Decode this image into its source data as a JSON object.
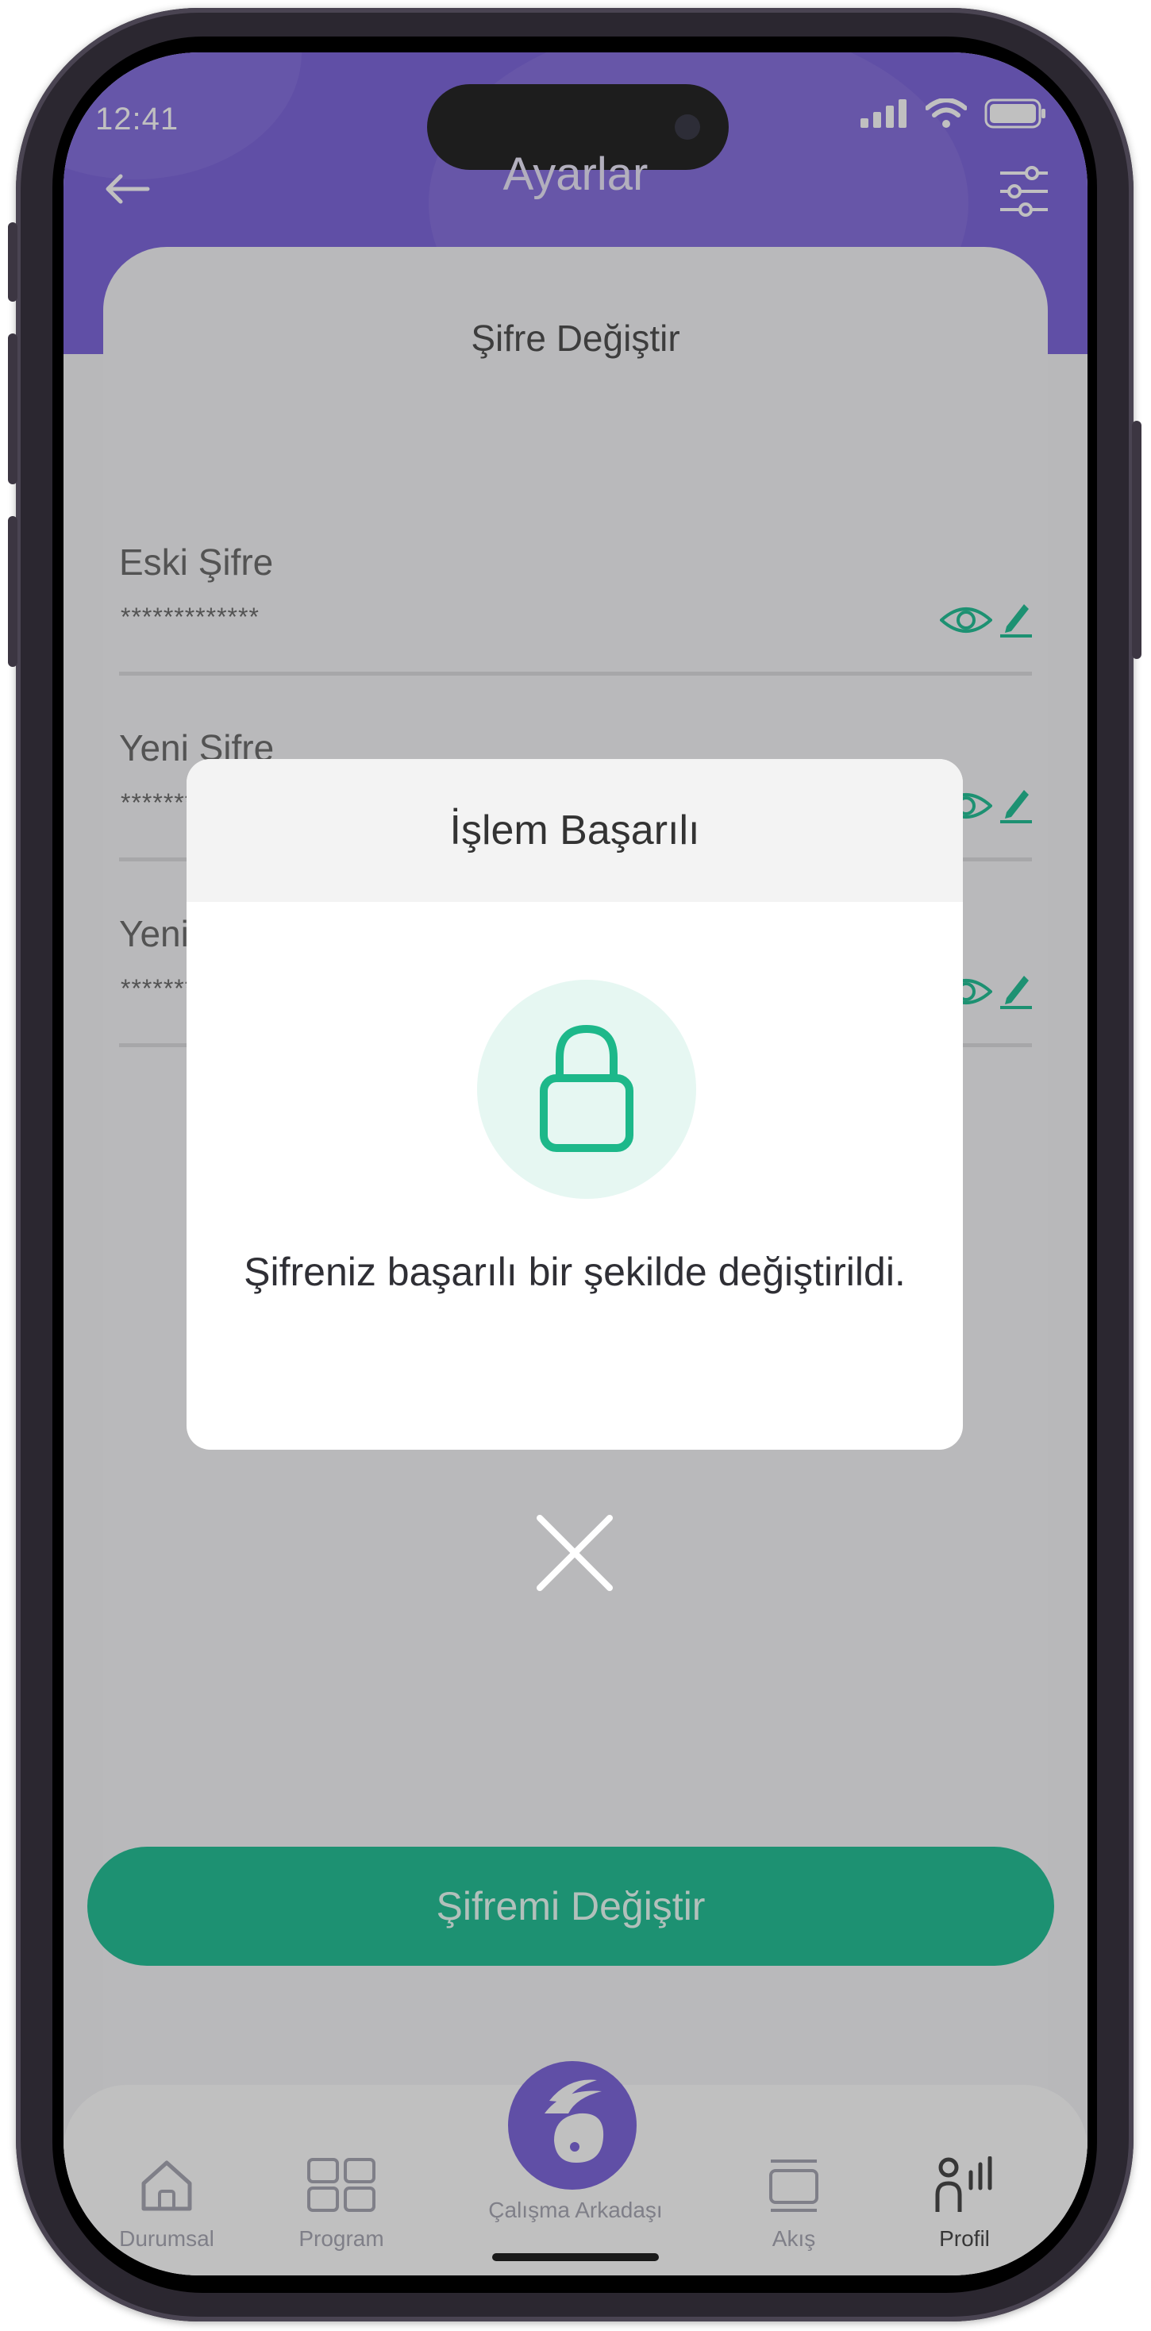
{
  "status_bar": {
    "time": "12:41"
  },
  "header": {
    "title": "Ayarlar",
    "back_icon": "arrow-left-icon",
    "settings_icon": "sliders-icon"
  },
  "card": {
    "title": "Şifre Değiştir"
  },
  "fields": [
    {
      "label": "Eski Şifre",
      "value": "*************"
    },
    {
      "label": "Yeni Şifre",
      "value": "*************"
    },
    {
      "label": "Yeni Şifre Tekrar",
      "value": "*************"
    }
  ],
  "submit_button": "Şifremi Değiştir",
  "tabs": [
    {
      "label": "Durumsal",
      "icon": "home-icon"
    },
    {
      "label": "Program",
      "icon": "grid-icon"
    },
    {
      "label": "Çalışma Arkadaşı",
      "icon": "bunny-icon"
    },
    {
      "label": "Akış",
      "icon": "feed-icon"
    },
    {
      "label": "Profil",
      "icon": "profile-icon"
    }
  ],
  "modal": {
    "title": "İşlem Başarılı",
    "icon": "lock-icon",
    "message": "Şifreniz başarılı bir şekilde değiştirildi.",
    "close_icon": "close-icon"
  },
  "colors": {
    "primary": "#6a4fd6",
    "accent": "#00b686",
    "accent_light": "#e6f7f2"
  }
}
